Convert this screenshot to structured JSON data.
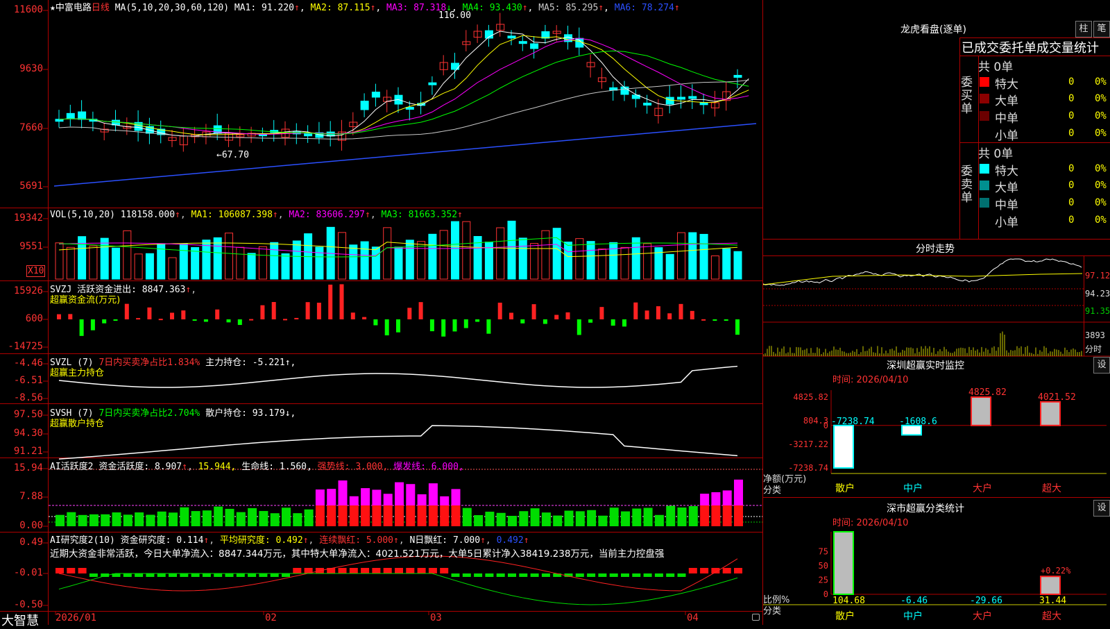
{
  "app": {
    "brand": "大智慧"
  },
  "stock": {
    "name": "中富电路",
    "period": "日线",
    "star": "★"
  },
  "price_pane": {
    "ma_line": "MA(5,10,20,30,60,120)",
    "ma": [
      {
        "label": "MA1: 91.220",
        "arrow": "↑",
        "color": "#ffffff"
      },
      {
        "label": "MA2: 87.115",
        "arrow": "↑",
        "color": "#ffff00"
      },
      {
        "label": "MA3: 87.318",
        "arrow": "↓",
        "color": "#ff00ff"
      },
      {
        "label": "MA4: 93.430",
        "arrow": "↑",
        "color": "#00ff00"
      },
      {
        "label": "MA5: 85.295",
        "arrow": "↑",
        "color": "#c8c8c8"
      },
      {
        "label": "MA6: 78.274",
        "arrow": "↑",
        "color": "#2b50ff"
      }
    ],
    "yticks": [
      "11600",
      "9630",
      "7660",
      "5691"
    ],
    "high_label": "116.00",
    "low_label": "←67.70"
  },
  "vol_pane": {
    "title": "VOL(5,10,20)",
    "value": "118158.000",
    "ma1": "MA1: 106087.398",
    "ma2": "MA2: 83606.297",
    "ma3": "MA3: 81663.352",
    "arrow": "↑",
    "yticks": [
      "19342",
      "9551"
    ],
    "unit": "X10"
  },
  "svzj_pane": {
    "title": "SVZJ",
    "label": "活跃资金进出: 8847.363",
    "arrow": "↑",
    "subtitle": "超赢资金流(万元)",
    "yticks": [
      "15926",
      "600",
      "-14725"
    ]
  },
  "svzl_pane": {
    "title": "SVZL (7)",
    "label1": "7日内买卖净占比1.834%",
    "label2": "主力持仓: -5.221",
    "arrow": "↑,",
    "subtitle": "超赢主力持仓",
    "yticks": [
      "-4.46",
      "-6.51",
      "-8.56"
    ]
  },
  "svsh_pane": {
    "title": "SVSH (7)",
    "label1": "7日内买卖净占比2.704%",
    "label2": "散户持仓: 93.179",
    "arrow": "↓,",
    "subtitle": "超赢散户持仓",
    "yticks": [
      "97.50",
      "94.30",
      "91.21"
    ]
  },
  "ai_active_pane": {
    "title": "AI活跃度2",
    "label1": "资金活跃度: 8.907",
    "label2": "15.944,",
    "label3": "生命线: 1.560,",
    "label4": "强势线: 3.000,",
    "label5": "爆发线: 6.000,",
    "yticks": [
      "15.94",
      "7.88",
      "0.00"
    ]
  },
  "ai_research_pane": {
    "title": "AI研究度2(10)",
    "label1": "资金研究度: 0.114",
    "label2": "平均研究度: 0.492",
    "label3": "连续飘红: 5.000",
    "label4": "N日飘红: 7.000",
    "label5": "0.492",
    "commentary": "近期大资金非常活跃，今日大单净流入：8847.344万元，其中特大单净流入：4021.521万元，大单5日累计净入38419.238万元，当前主力控盘强",
    "yticks": [
      "0.49",
      "-0.01",
      "-0.50"
    ]
  },
  "x_axis": {
    "labels": [
      "2026/01",
      "02",
      "03",
      "04"
    ]
  },
  "right": {
    "lhb_title": "龙虎看盘(逐单)",
    "btn_zhu": "柱",
    "btn_bi": "笔",
    "table_header": "已成交委托单成交量统计",
    "buy_side": {
      "label": "委买单",
      "total": "共 0单",
      "rows": [
        {
          "name": "特大",
          "count": "0",
          "pct": "0%",
          "color": "#ff0000"
        },
        {
          "name": "大单",
          "count": "0",
          "pct": "0%",
          "color": "#8b0000"
        },
        {
          "name": "中单",
          "count": "0",
          "pct": "0%",
          "color": "#6b0000"
        },
        {
          "name": "小单",
          "count": "0",
          "pct": "0%",
          "color": ""
        }
      ]
    },
    "sell_side": {
      "label": "委卖单",
      "total": "共 0单",
      "rows": [
        {
          "name": "特大",
          "count": "0",
          "pct": "0%",
          "color": "#00ffff"
        },
        {
          "name": "大单",
          "count": "0",
          "pct": "0%",
          "color": "#009090"
        },
        {
          "name": "中单",
          "count": "0",
          "pct": "0%",
          "color": "#007070"
        },
        {
          "name": "小单",
          "count": "0",
          "pct": "0%",
          "color": ""
        }
      ]
    },
    "intraday": {
      "title": "分时走势",
      "yticks": [
        "97.12",
        "94.23",
        "91.35"
      ],
      "vol_tick": "3893",
      "vol_unit": "分时"
    },
    "monitor": {
      "title": "深圳超赢实时监控",
      "btn": "设",
      "time": "时间: 2026/04/10",
      "yticks": [
        "4825.82",
        "804.3",
        "0",
        "-3217.22",
        "-7238.74"
      ],
      "ylabel1": "净额(万元)",
      "ylabel2": "分类",
      "categories": [
        "散户",
        "中户",
        "大户",
        "超大"
      ],
      "values": [
        -7238.74,
        -1608.6,
        4825.82,
        4021.52
      ],
      "value_labels": [
        "-7238.74",
        "-1608.6",
        "4825.82",
        "4021.52"
      ]
    },
    "classify": {
      "title": "深市超赢分类统计",
      "btn": "设",
      "time": "时间: 2026/04/10",
      "yticks": [
        "75",
        "50",
        "25",
        "0"
      ],
      "ylabel1": "比例%",
      "ylabel2": "分类",
      "categories": [
        "散户",
        "中户",
        "大户",
        "超大"
      ],
      "values": [
        104.68,
        -6.46,
        -29.66,
        31.44
      ],
      "value_labels": [
        "104.68",
        "-6.46",
        "-29.66",
        "31.44"
      ],
      "extra_label": "+0.22%"
    }
  },
  "chart_data": [
    {
      "type": "bar",
      "title": "深圳超赢实时监控",
      "categories": [
        "散户",
        "中户",
        "大户",
        "超大"
      ],
      "values": [
        -7238.74,
        -1608.6,
        4825.82,
        4021.52
      ],
      "ylabel": "净额(万元)",
      "ylim": [
        -7238.74,
        4825.82
      ]
    },
    {
      "type": "bar",
      "title": "深市超赢分类统计",
      "categories": [
        "散户",
        "中户",
        "大户",
        "超大"
      ],
      "values": [
        104.68,
        -6.46,
        -29.66,
        31.44
      ],
      "ylabel": "比例%",
      "ylim": [
        0,
        75
      ]
    }
  ]
}
